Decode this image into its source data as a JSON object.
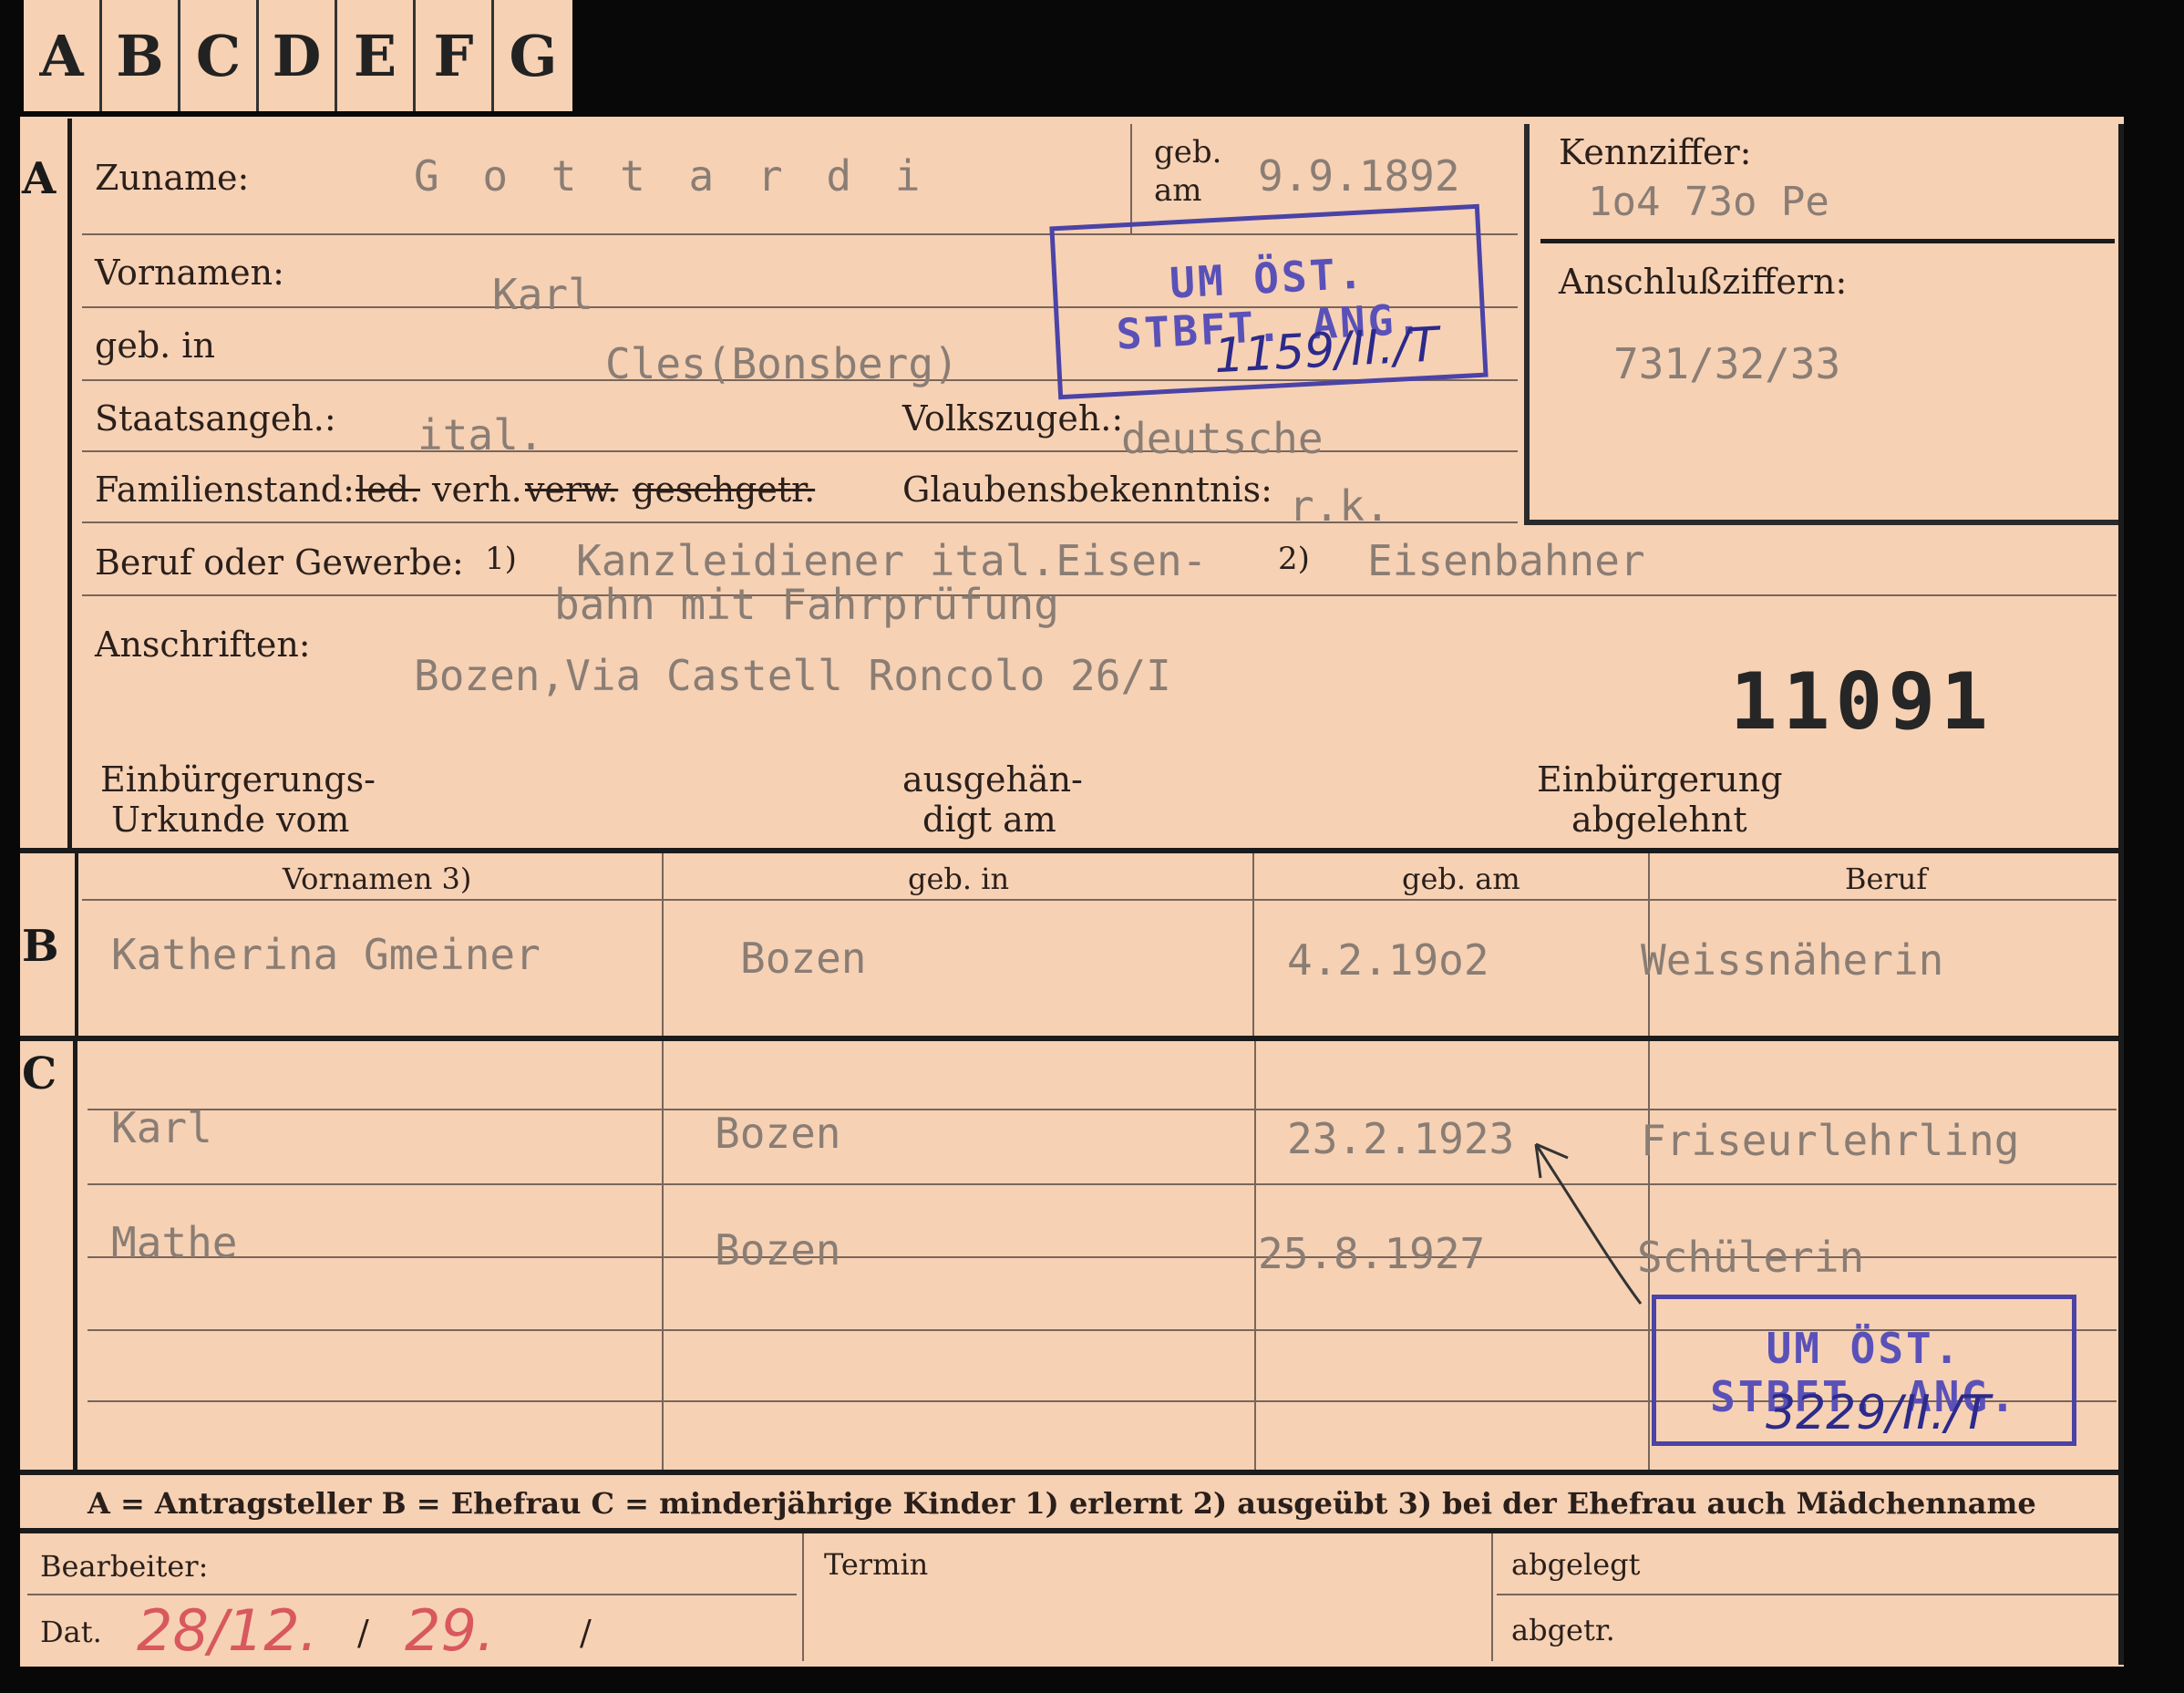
{
  "tabs": [
    "A",
    "B",
    "C",
    "D",
    "E",
    "F",
    "G"
  ],
  "section_letters": {
    "a": "A",
    "b": "B",
    "c": "C"
  },
  "labels": {
    "zuname": "Zuname:",
    "geb_am_1": "geb.",
    "geb_am_2": "am",
    "kennziffer": "Kennziffer:",
    "vornamen": "Vornamen:",
    "anschlussziffern": "Anschlußziffern:",
    "geb_in": "geb. in",
    "staatsangeh": "Staatsangeh.:",
    "volkszugeh": "Volkszugeh.:",
    "familienstand": "Familienstand:",
    "fam_led": "led.",
    "fam_verh": "verh.",
    "fam_verw": "verw.",
    "fam_gesch": "gesch.",
    "fam_getr": "getr.",
    "glaubensbekenntnis": "Glaubensbekenntnis:",
    "beruf": "Beruf oder Gewerbe:",
    "beruf_m1": "1)",
    "beruf_m2": "2)",
    "anschriften": "Anschriften:",
    "einb_urkunde_1": "Einbürgerungs-",
    "einb_urkunde_2": "Urkunde vom",
    "ausgehaendigt_1": "ausgehän-",
    "ausgehaendigt_2": "digt am",
    "einb_abgelehnt_1": "Einbürgerung",
    "einb_abgelehnt_2": "abgelehnt",
    "col_vornamen": "Vornamen 3)",
    "col_geb_in": "geb. in",
    "col_geb_am": "geb. am",
    "col_beruf": "Beruf",
    "bearbeiter": "Bearbeiter:",
    "termin": "Termin",
    "abgelegt": "abgelegt",
    "dat": "Dat.",
    "abgetr": "abgetr."
  },
  "legend": "A = Antragsteller   B = Ehefrau   C = minderjährige Kinder   1) erlernt   2) ausgeübt   3) bei der Ehefrau auch Mädchenname",
  "values": {
    "zuname": "G o t t a r d i",
    "geb_am": "9.9.1892",
    "kennziffer": "1o4 73o  Pe",
    "vornamen": "Karl",
    "anschlussziffern": "731/32/33",
    "geb_in": "Cles(Bonsberg)",
    "staatsangeh": "ital.",
    "volkszugeh": "deutsche",
    "glaubensbekenntnis": "r.k.",
    "beruf_erlernt_1": "Kanzleidiener ital.Eisen-",
    "beruf_erlernt_2": "bahn mit Fahrprüfung",
    "beruf_ausgeuebt": "Eisenbahner",
    "anschrift": "Bozen,Via Castell Roncolo 26/I",
    "card_number": "11091"
  },
  "ehefrau": {
    "vornamen": "Katherina Gmeiner",
    "geb_in": "Bozen",
    "geb_am": "4.2.19o2",
    "beruf": "Weissnäherin"
  },
  "kinder": [
    {
      "vornamen": "Karl",
      "geb_in": "Bozen",
      "geb_am": "23.2.1923",
      "beruf": "Friseurlehrling"
    },
    {
      "vornamen": "Mathe",
      "geb_in": "Bozen",
      "geb_am": "25.8.1927",
      "beruf": "Schülerin"
    }
  ],
  "stamps": [
    {
      "line1": "UM ÖST.",
      "line2": "STBFT. ANG.",
      "handwritten": "1159/II./T"
    },
    {
      "line1": "UM ÖST.",
      "line2": "STBFT. ANG.",
      "handwritten": "3229/II./T"
    }
  ],
  "handwritten_date": {
    "part1": "28/12.",
    "part2": "29.",
    "slash1": "/",
    "slash2": "/"
  },
  "colors": {
    "card": "#f6d1b4",
    "stamp": "#4b43a6",
    "red_ink": "#d8585d"
  }
}
